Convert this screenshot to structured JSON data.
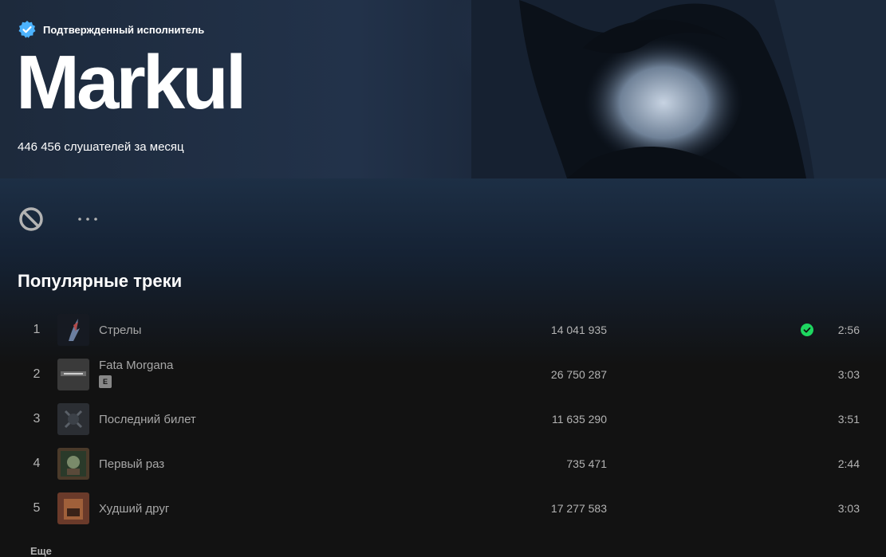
{
  "header": {
    "verified_label": "Подтвержденный исполнитель",
    "artist_name": "Markul",
    "monthly_listeners": "446 456 слушателей за месяц"
  },
  "controls": {
    "block_icon": "block-icon",
    "more_icon": "more-icon"
  },
  "popular": {
    "title": "Популярные треки",
    "tracks": [
      {
        "num": "1",
        "title": "Стрелы",
        "plays": "14 041 935",
        "duration": "2:56",
        "saved": true,
        "explicit": false
      },
      {
        "num": "2",
        "title": "Fata Morgana",
        "plays": "26 750 287",
        "duration": "3:03",
        "saved": false,
        "explicit": true,
        "badge": "E"
      },
      {
        "num": "3",
        "title": "Последний билет",
        "plays": "11 635 290",
        "duration": "3:51",
        "saved": false,
        "explicit": false
      },
      {
        "num": "4",
        "title": "Первый раз",
        "plays": "735 471",
        "duration": "2:44",
        "saved": false,
        "explicit": false
      },
      {
        "num": "5",
        "title": "Худший друг",
        "plays": "17 277 583",
        "duration": "3:03",
        "saved": false,
        "explicit": false
      }
    ],
    "more_label": "Еще"
  },
  "colors": {
    "accent_green": "#1ed760",
    "verified_blue": "#4cb3ff",
    "background": "#121212"
  }
}
